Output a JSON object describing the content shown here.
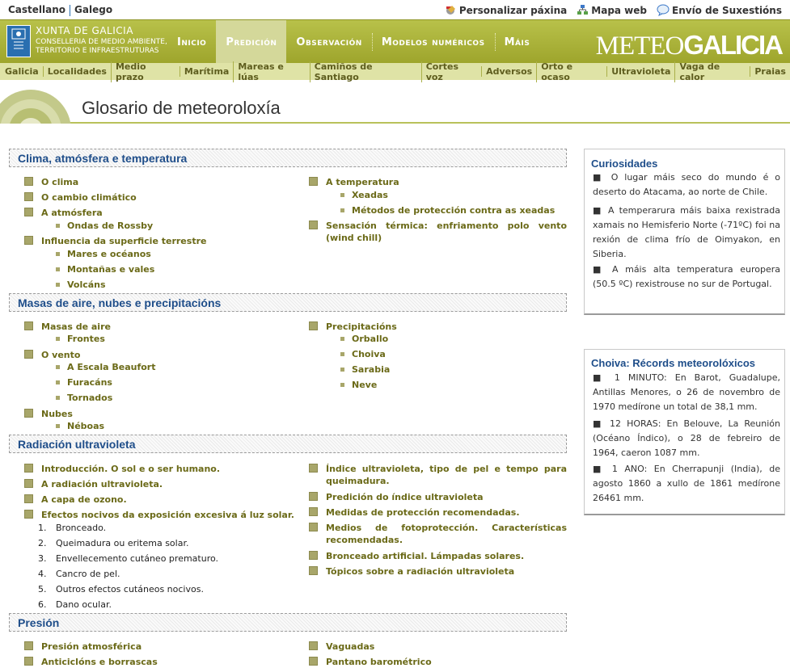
{
  "top": {
    "languages": [
      "Castellano",
      "Galego"
    ],
    "links": [
      {
        "label": "Personalizar páxina",
        "icon": "customize-icon"
      },
      {
        "label": "Mapa web",
        "icon": "sitemap-icon"
      },
      {
        "label": "Envío de Suxestións",
        "icon": "speech-bubble-icon"
      }
    ]
  },
  "header": {
    "xunta_title": "XUNTA DE GALICIA",
    "xunta_sub1": "CONSELLERIA DE MEDIO AMBIENTE,",
    "xunta_sub2": "TERRITORIO E INFRAESTRUTURAS",
    "brand_light": "METEO",
    "brand_bold": "GALICIA",
    "nav": [
      "Inicio",
      "Predición",
      "Observación",
      "Modelos numéricos",
      "Máis"
    ],
    "active_nav": "Predición"
  },
  "subnav": [
    "Galicia",
    "Localidades",
    "Medio prazo",
    "Marítima",
    "Mareas e lúas",
    "Camiños de Santiago",
    "Cortes voz",
    "Adversos",
    "Orto e ocaso",
    "Ultravioleta",
    "Vaga de calor",
    "Praias"
  ],
  "page_title": "Glosario de meteoroloxía",
  "sections": {
    "clima": {
      "title": "Clima, atmósfera e temperatura",
      "left": {
        "o_clima": "O clima",
        "cambio": "O cambio climático",
        "atmosfera": "A atmósfera",
        "rossby": "Ondas de Rossby",
        "influencia": "Influencia da superficie terrestre",
        "mares": "Mares e océanos",
        "montanas": "Montañas e vales",
        "volcans": "Volcáns"
      },
      "right": {
        "temperatura": "A temperatura",
        "xeadas": "Xeadas",
        "metodos": "Métodos de protección contra as xeadas",
        "sensacion": "Sensación térmica: enfriamento polo vento (wind chill)"
      }
    },
    "masas": {
      "title": "Masas de aire, nubes e precipitacións",
      "left": {
        "masas": "Masas de aire",
        "frontes": "Frontes",
        "vento": "O vento",
        "beaufort": "A Escala Beaufort",
        "furacans": "Furacáns",
        "tornados": "Tornados",
        "nubes": "Nubes",
        "neboas": "Néboas"
      },
      "right": {
        "precipitacions": "Precipitacións",
        "orballo": "Orballo",
        "choiva": "Choiva",
        "sarabia": "Sarabia",
        "neve": "Neve"
      }
    },
    "radiacion": {
      "title": "Radiación ultravioleta",
      "left": {
        "intro": "Introducción. O sol e o ser humano.",
        "radiacion": "A radiación ultravioleta.",
        "ozono": "A capa de ozono.",
        "efectos": "Efectos nocivos da exposición excesiva á luz solar.",
        "list": [
          "Bronceado.",
          "Queimadura ou eritema solar.",
          "Envellecemento cutáneo prematuro.",
          "Cancro de pel.",
          "Outros efectos cutáneos nocivos.",
          "Dano ocular."
        ]
      },
      "right": {
        "indice": "Índice ultravioleta, tipo de pel e tempo para queimadura.",
        "predicion": "Predición do índice ultravioleta",
        "medidas": "Medidas de protección recomendadas.",
        "medios": "Medios de fotoprotección. Características recomendadas.",
        "bronceado": "Bronceado artificial. Lámpadas solares.",
        "topicos": "Tópicos sobre a radiación ultravioleta"
      }
    },
    "presion": {
      "title": "Presión",
      "left": {
        "presion": "Presión atmosférica",
        "anticiclons": "Anticiclóns e borrascas"
      },
      "right": {
        "vaguadas": "Vaguadas",
        "pantano": "Pantano barométrico"
      }
    }
  },
  "curiosidades": {
    "title": "Curiosidades",
    "items": [
      "O lugar máis seco do mundo é o deserto do Atacama, ao norte de Chile.",
      "A temperarura máis baixa rexistrada xamais no Hemisferio Norte (-71ºC) foi na rexión de clima frío de Oimyakon, en Siberia.",
      "A máis alta temperatura europera (50.5 ºC) rexistrouse no sur de Portugal."
    ]
  },
  "records": {
    "title": "Choiva: Récords meteorolóxicos",
    "items": [
      "1 MINUTO: En Barot, Guadalupe, Antillas Menores, o 26 de novembro de 1970 medírone un total de 38,1 mm.",
      "12 HORAS: En Belouve, La Reunión (Océano Índico), o 28 de febreiro de 1964, caeron 1087 mm.",
      "1 ANO: En Cherrapunji (India), de agosto 1860 a xullo de 1861 medírone 26461 mm."
    ]
  },
  "colors": {
    "accent": "#a3aa31",
    "subnav": "#dfe3a6",
    "heading": "#1f4e8a",
    "link": "#6b6a18"
  }
}
